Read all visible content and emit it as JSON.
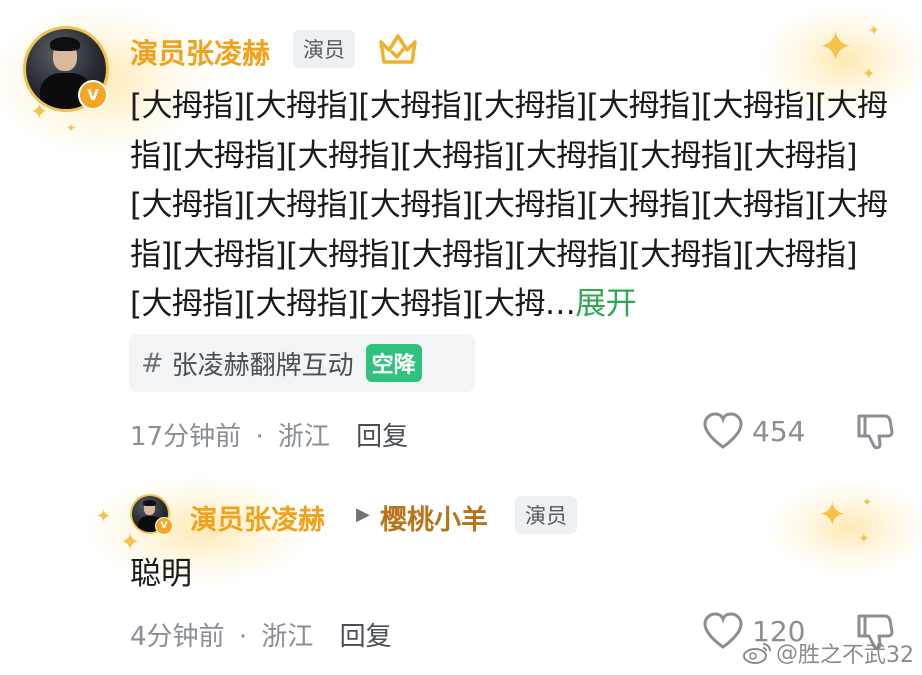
{
  "comment": {
    "author_name": "演员张凌赫",
    "author_tag": "演员",
    "verified_badge": "V",
    "text": "[大拇指][大拇指][大拇指][大拇指][大拇指][大拇指][大拇指][大拇指][大拇指][大拇指][大拇指][大拇指][大拇指][大拇指][大拇指][大拇指][大拇指][大拇指][大拇指][大拇指][大拇指][大拇指][大拇指][大拇指][大拇指][大拇指][大拇指][大拇指][大拇指][大拇",
    "ellipsis": "…",
    "expand_label": "展开",
    "topic": {
      "hash": "#",
      "label": "张凌赫翻牌互动",
      "badge": "空降"
    },
    "time": "17分钟前",
    "separator": "·",
    "location": "浙江",
    "reply_label": "回复",
    "likes": "454"
  },
  "reply": {
    "author_name": "演员张凌赫",
    "arrow": "▶",
    "target_name": "樱桃小羊",
    "target_tag": "演员",
    "text": "聪明",
    "time": "4分钟前",
    "separator": "·",
    "location": "浙江",
    "reply_label": "回复",
    "likes": "120"
  },
  "watermark": {
    "at": "@",
    "name": "胜之不武32"
  },
  "colors": {
    "name": "#f0a21a",
    "expand": "#2fa84f",
    "topic_badge": "#2ec27e",
    "muted": "#8a8f95"
  },
  "icons": [
    "crown-badge-icon",
    "verified-v-icon",
    "heart-icon",
    "thumbs-down-icon",
    "weibo-logo-icon",
    "sparkle-icon"
  ]
}
